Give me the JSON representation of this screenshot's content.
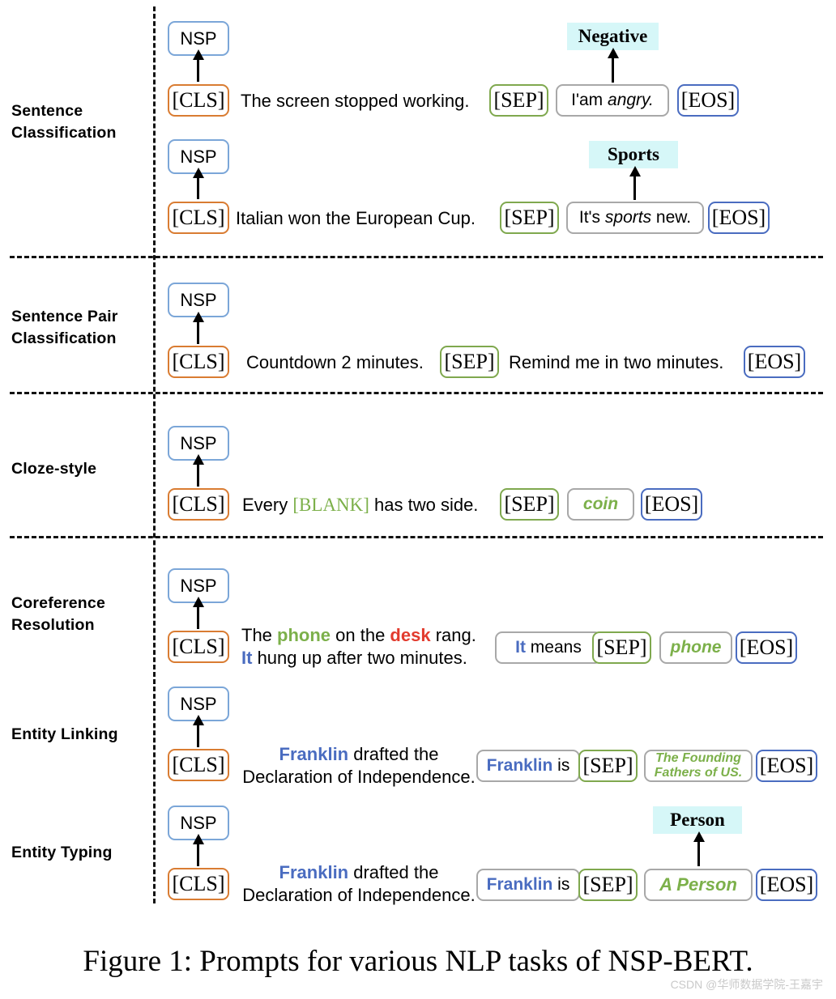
{
  "figure": {
    "caption": "Figure 1: Prompts for various NLP tasks of NSP-BERT.",
    "watermark": "CSDN @华师数据学院-王嘉宇"
  },
  "tokens": {
    "nsp": "NSP",
    "cls": "[CLS]",
    "sep": "[SEP]",
    "eos": "[EOS]",
    "blank": "[BLANK]"
  },
  "colors": {
    "cls_border": "#d97c32",
    "sep_border": "#7fa84e",
    "eos_border": "#4a6cc0",
    "nsp_border": "#7ba6d8",
    "gray_border": "#a8a8a8",
    "chip_bg": "#d6f7f8",
    "green_text": "#7cb04a",
    "red_text": "#e23b2e",
    "blue_text": "#4a6cc0"
  },
  "tasks": [
    {
      "label": "Sentence\nClassification",
      "label_line1": "Sentence",
      "label_line2": "Classification",
      "examples": [
        {
          "premise": "The screen stopped working.",
          "hypothesis": "I'am angry.",
          "hypothesis_plain": "I'am ",
          "hypothesis_emph": "angry.",
          "answer_label": "Negative"
        },
        {
          "premise": "Italian won the European Cup.",
          "hypothesis": "It's sports new.",
          "hypothesis_pre": "It's ",
          "hypothesis_emph": "sports",
          "hypothesis_post": " new.",
          "answer_label": "Sports"
        }
      ]
    },
    {
      "label": "Sentence Pair Classification",
      "label_line1": "Sentence Pair",
      "label_line2": "Classification",
      "examples": [
        {
          "premise": "Countdown 2 minutes.",
          "hypothesis": "Remind me in two minutes."
        }
      ]
    },
    {
      "label": "Cloze-style",
      "label_line1": "Cloze-style",
      "examples": [
        {
          "premise_pre": "Every ",
          "premise_blank": "[BLANK]",
          "premise_post": " has two side.",
          "hypothesis": "coin"
        }
      ]
    },
    {
      "label": "Coreference Resolution",
      "label_line1": "Coreference",
      "label_line2": "Resolution",
      "examples": [
        {
          "premise_line1_a": "The ",
          "premise_line1_green": "phone",
          "premise_line1_b": " on the ",
          "premise_line1_red": "desk",
          "premise_line1_c": " rang.",
          "premise_line2_blue": "It",
          "premise_line2_rest": " hung up after two minutes.",
          "hypothesis_blue": "It",
          "hypothesis_rest": " means",
          "answer": "phone"
        }
      ]
    },
    {
      "label": "Entity Linking",
      "label_line1": "Entity Linking",
      "examples": [
        {
          "premise_blue": "Franklin",
          "premise_rest": " drafted the",
          "premise_line2": "Declaration of Independence.",
          "hypothesis_blue": "Franklin",
          "hypothesis_rest": " is",
          "answer_line1": "The Founding",
          "answer_line2": "Fathers of US."
        }
      ]
    },
    {
      "label": "Entity Typing",
      "label_line1": "Entity Typing",
      "examples": [
        {
          "premise_blue": "Franklin",
          "premise_rest": " drafted the",
          "premise_line2": "Declaration of Independence.",
          "hypothesis_blue": "Franklin",
          "hypothesis_rest": " is",
          "answer": "A Person",
          "answer_label": "Person"
        }
      ]
    }
  ]
}
